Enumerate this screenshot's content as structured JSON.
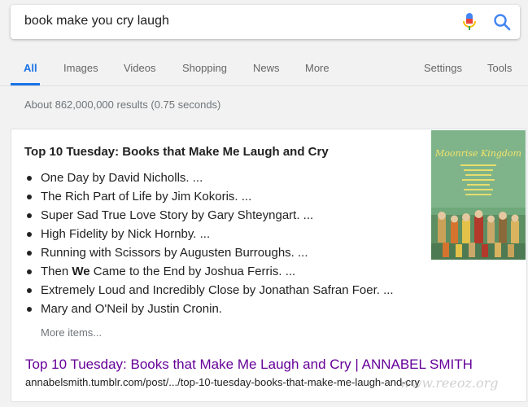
{
  "search": {
    "query": "book make you cry laugh"
  },
  "tabs": [
    {
      "label": "All"
    },
    {
      "label": "Images"
    },
    {
      "label": "Videos"
    },
    {
      "label": "Shopping"
    },
    {
      "label": "News"
    },
    {
      "label": "More"
    },
    {
      "label": "Settings"
    },
    {
      "label": "Tools"
    }
  ],
  "stats": "About 862,000,000 results (0.75 seconds)",
  "card": {
    "title": "Top 10 Tuesday: Books that Make Me Laugh and Cry",
    "items": [
      {
        "before": "One Day by David Nicholls. ...",
        "bold": "",
        "after": ""
      },
      {
        "before": "The Rich Part of Life by Jim Kokoris. ...",
        "bold": "",
        "after": ""
      },
      {
        "before": "Super Sad True Love Story by Gary Shteyngart. ...",
        "bold": "",
        "after": ""
      },
      {
        "before": "High Fidelity by Nick Hornby. ...",
        "bold": "",
        "after": ""
      },
      {
        "before": "Running with Scissors by Augusten Burroughs. ...",
        "bold": "",
        "after": ""
      },
      {
        "before": "Then ",
        "bold": "We",
        "after": " Came to the End by Joshua Ferris. ..."
      },
      {
        "before": "Extremely Loud and Incredibly Close by Jonathan Safran Foer. ...",
        "bold": "",
        "after": ""
      },
      {
        "before": "Mary and O'Neil by Justin Cronin.",
        "bold": "",
        "after": ""
      }
    ],
    "more_items": "More items...",
    "result_title": "Top 10 Tuesday: Books that Make Me Laugh and Cry | ANNABEL SMITH",
    "result_url": "annabelsmith.tumblr.com/post/.../top-10-tuesday-books-that-make-me-laugh-and-cry",
    "poster_text": "Moonrise Kingdom"
  },
  "watermark": "www.reeoz.org",
  "colors": {
    "link": "#660099",
    "accent": "#1a73e8"
  }
}
